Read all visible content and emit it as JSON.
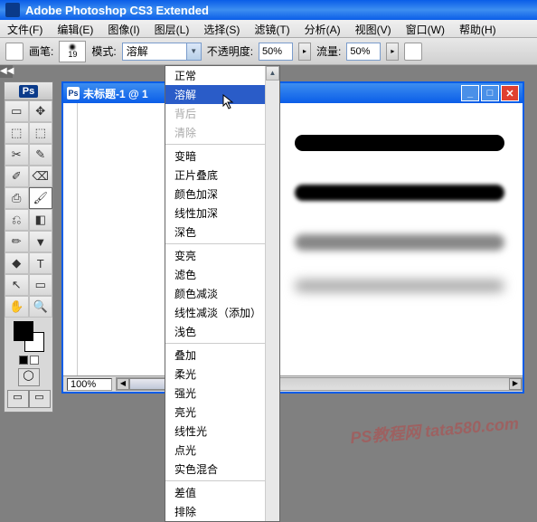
{
  "app": {
    "title": "Adobe Photoshop CS3 Extended",
    "badge": "Ps"
  },
  "menus": [
    "文件(F)",
    "编辑(E)",
    "图像(I)",
    "图层(L)",
    "选择(S)",
    "滤镜(T)",
    "分析(A)",
    "视图(V)",
    "窗口(W)",
    "帮助(H)"
  ],
  "options": {
    "brush_label": "画笔:",
    "brush_size": "19",
    "mode_label": "模式:",
    "mode_value": "溶解",
    "opacity_label": "不透明度:",
    "opacity_value": "50%",
    "flow_label": "流量:",
    "flow_value": "50%"
  },
  "toggle": "◀◀",
  "tools": [
    "▭",
    "✥",
    "⬚",
    "⬚",
    "✂",
    "✎",
    "✐",
    "⌫",
    "⎙",
    "🖌",
    "⎌",
    "◧",
    "✏",
    "▼",
    "◆",
    "T",
    "↖",
    "▭",
    "✋",
    "🔍"
  ],
  "document": {
    "title": "未标题-1 @ 1",
    "zoom": "100%"
  },
  "dropdown": {
    "groups": [
      [
        "正常",
        "溶解",
        "背后",
        "清除"
      ],
      [
        "变暗",
        "正片叠底",
        "颜色加深",
        "线性加深",
        "深色"
      ],
      [
        "变亮",
        "滤色",
        "颜色减淡",
        "线性减淡（添加）",
        "浅色"
      ],
      [
        "叠加",
        "柔光",
        "强光",
        "亮光",
        "线性光",
        "点光",
        "实色混合"
      ],
      [
        "差值",
        "排除"
      ]
    ],
    "highlighted": "溶解",
    "disabled": [
      "背后",
      "清除"
    ]
  },
  "watermark": "PS教程网 tata580.com"
}
